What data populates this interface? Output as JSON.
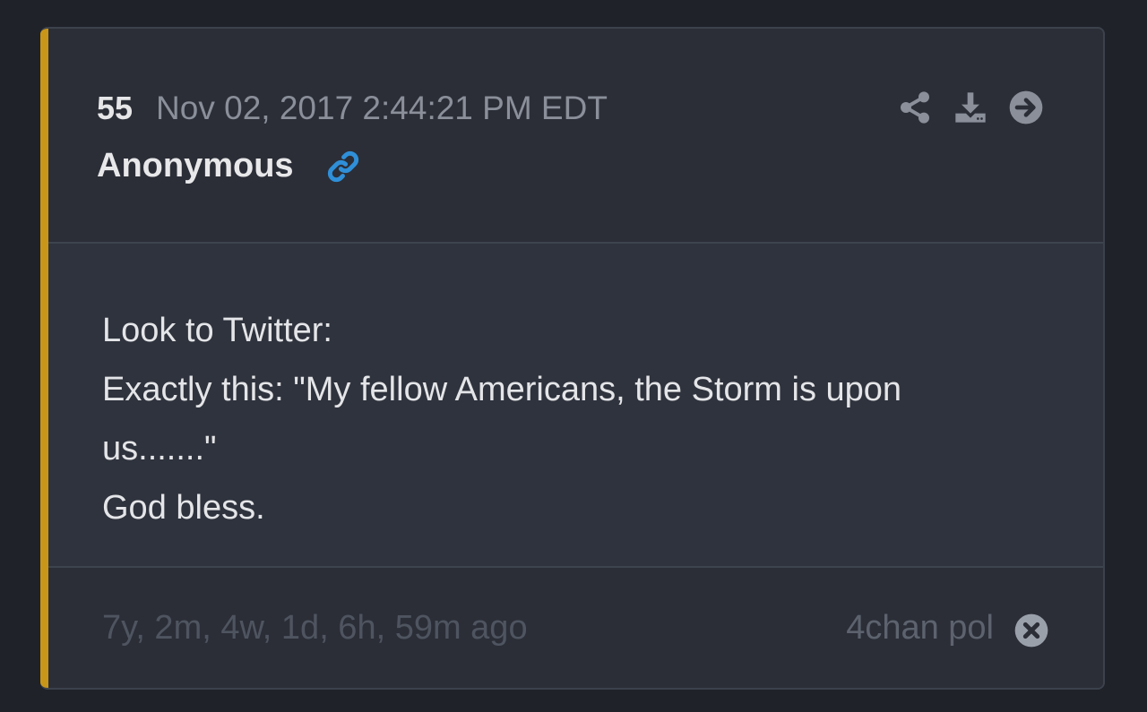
{
  "post": {
    "number": "55",
    "timestamp": "Nov 02, 2017 2:44:21 PM EDT",
    "author": "Anonymous",
    "lines": [
      "Look to Twitter:",
      "Exactly this: \"My fellow Americans, the Storm is upon us.......\"",
      "God bless."
    ],
    "age": "7y, 2m, 4w, 1d, 6h, 59m ago",
    "source": "4chan pol"
  },
  "icons": {
    "author_link": "link-icon",
    "actions": [
      "share-icon",
      "download-icon",
      "arrow-right-circle-icon"
    ],
    "footer": "close-circle-icon"
  },
  "colors": {
    "background": "#1f2229",
    "card": "#2b2e37",
    "body": "#2f333d",
    "accent": "#c9961a",
    "link": "#2f8fd8",
    "muted_icon": "#8a8f99",
    "close_icon": "#9aa0aa"
  }
}
